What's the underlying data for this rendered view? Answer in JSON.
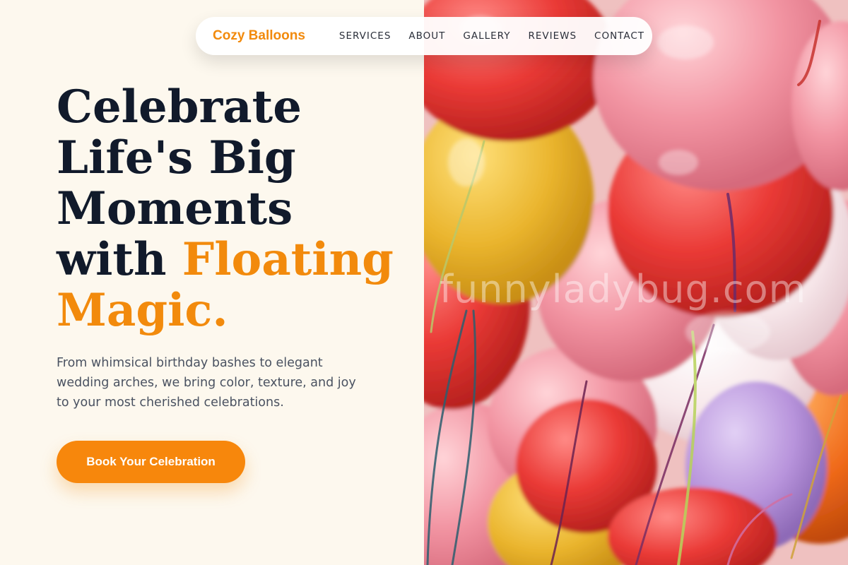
{
  "brand": {
    "name": "Cozy Balloons"
  },
  "nav": {
    "links": [
      "SERVICES",
      "ABOUT",
      "GALLERY",
      "REVIEWS",
      "CONTACT"
    ]
  },
  "hero": {
    "headline_lines": [
      "Celebrate",
      "Life's Big",
      "Moments"
    ],
    "headline_with": "with ",
    "headline_accent_1": "Floating",
    "headline_accent_2": "Magic.",
    "subtext": "From whimsical birthday bashes to elegant wedding arches, we bring color, texture, and joy to your most cherished celebrations.",
    "cta_label": "Book Your Celebration",
    "photo_watermark": "funnyladybug.com"
  },
  "colors": {
    "accent": "#f28a0c",
    "heading": "#111a2b",
    "body": "#4a5261",
    "background": "#fdf8ee"
  }
}
